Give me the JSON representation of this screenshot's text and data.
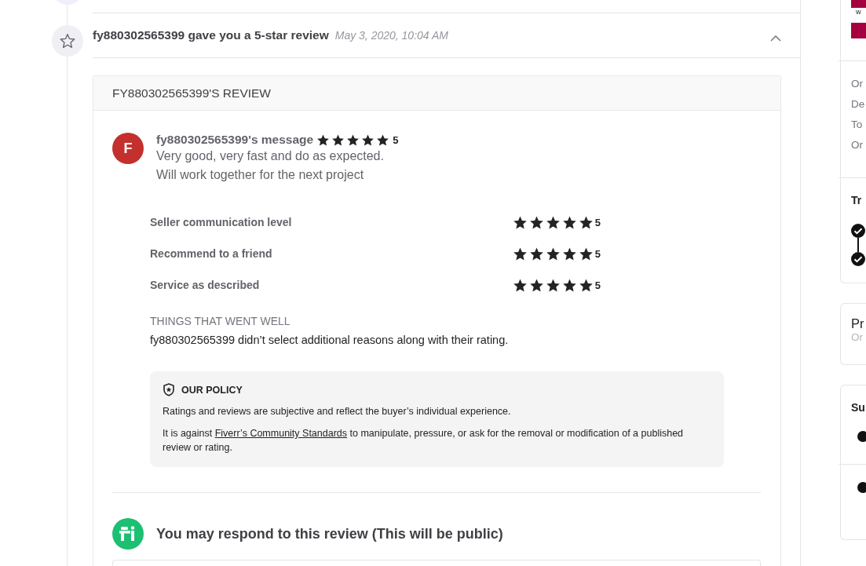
{
  "event": {
    "title": "fy880302565399 gave you a 5-star review",
    "time": "May 3, 2020, 10:04 AM",
    "expanded": true
  },
  "review": {
    "heading": "FY880302565399'S REVIEW",
    "avatar_letter": "F",
    "author_label": "fy880302565399's message",
    "stars": 5,
    "score": "5",
    "message_lines": [
      "Very good, very fast and do as expected.",
      "Will work together for the next project"
    ],
    "criteria": [
      {
        "label": "Seller communication level",
        "stars": 5,
        "score": "5"
      },
      {
        "label": "Recommend to a friend",
        "stars": 5,
        "score": "5"
      },
      {
        "label": "Service as described",
        "stars": 5,
        "score": "5"
      }
    ],
    "went_well": {
      "heading": "THINGS THAT WENT WELL",
      "text": "fy880302565399 didn’t select additional reasons along with their rating."
    },
    "policy": {
      "heading": "OUR POLICY",
      "paragraph": "Ratings and reviews are subjective and reflect the buyer’s individual experience.",
      "rule_before": "It is against ",
      "rule_link": "Fiverr’s Community Standards",
      "rule_after": " to manipulate, pressure, or ask for the removal or modification of a published review or rating."
    },
    "respond": {
      "title": "You may respond to this review (This will be public)"
    }
  },
  "sidebar": {
    "banner_text": "w",
    "order_lines": [
      "Or",
      "De",
      "To",
      "Or"
    ],
    "track_title": "Tr",
    "track_steps": [
      {
        "done": true
      },
      {
        "done": true
      }
    ],
    "card_2": {
      "title": "Pr",
      "subtitle": "Or"
    },
    "card_3": {
      "title": "Su"
    }
  }
}
